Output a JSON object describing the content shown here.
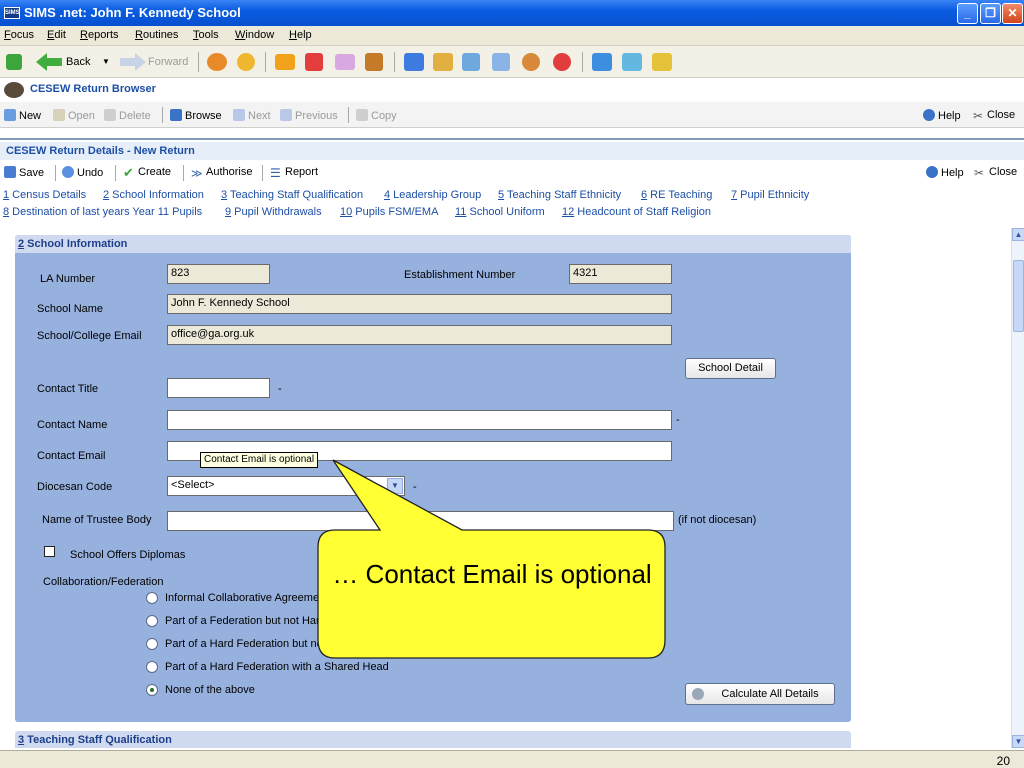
{
  "window": {
    "title": "SIMS .net: John F. Kennedy School",
    "logo_text": "SIMS"
  },
  "menu": [
    "Focus",
    "Edit",
    "Reports",
    "Routines",
    "Tools",
    "Window",
    "Help"
  ],
  "nav": {
    "back": "Back",
    "forward": "Forward"
  },
  "browser": {
    "title": "CESEW Return Browser",
    "tools": {
      "new": "New",
      "open": "Open",
      "delete": "Delete",
      "browse": "Browse",
      "next": "Next",
      "previous": "Previous",
      "copy": "Copy",
      "help": "Help",
      "close": "Close"
    }
  },
  "details": {
    "title": "CESEW Return Details - New Return",
    "tools": {
      "save": "Save",
      "undo": "Undo",
      "create": "Create",
      "authorise": "Authorise",
      "report": "Report",
      "help": "Help",
      "close": "Close"
    },
    "links_row1": [
      {
        "num": "1",
        "label": " Census Details"
      },
      {
        "num": "2",
        "label": " School Information"
      },
      {
        "num": "3",
        "label": " Teaching Staff Qualification"
      },
      {
        "num": "4",
        "label": " Leadership Group"
      },
      {
        "num": "5",
        "label": " Teaching Staff Ethnicity"
      },
      {
        "num": "6",
        "label": " RE Teaching"
      },
      {
        "num": "7",
        "label": " Pupil Ethnicity"
      }
    ],
    "links_row2": [
      {
        "num": "8",
        "label": " Destination of last years Year 11 Pupils"
      },
      {
        "num": "9",
        "label": " Pupil Withdrawals"
      },
      {
        "num": "10",
        "label": " Pupils FSM/EMA"
      },
      {
        "num": "11",
        "label": " School Uniform"
      },
      {
        "num": "12",
        "label": " Headcount of Staff Religion"
      }
    ]
  },
  "section": {
    "num": "2",
    "title": " School Information",
    "la_number_label": "LA Number",
    "la_number": "823",
    "establishment_label": "Establishment Number",
    "establishment": "4321",
    "school_name_label": "School Name",
    "school_name": "John F. Kennedy School",
    "email_label": "School/College Email",
    "email": "office@ga.org.uk",
    "school_detail_btn": "School Detail",
    "contact_title_label": "Contact Title",
    "contact_name_label": "Contact Name",
    "contact_email_label": "Contact Email",
    "diocesan_label": "Diocesan Code",
    "diocesan_value": "<Select>",
    "trustee_label": "Name of Trustee Body",
    "trustee_note": "(if not diocesan)",
    "diplomas_label": "School Offers Diplomas",
    "collab_label": "Collaboration/Federation",
    "radios": [
      "Informal Collaborative Agreement",
      "Part of a Federation but not Hard",
      "Part of a Hard Federation but no",
      "Part of a Hard Federation with a Shared Head",
      "None of the above"
    ],
    "selected_radio": 4,
    "calc_btn": "Calculate All Details",
    "required_mark": "-"
  },
  "next_section": {
    "num": "3",
    "title": " Teaching Staff Qualification"
  },
  "tooltip": "Contact Email is optional",
  "callout": "… Contact Email is optional",
  "status": {
    "page_number": "20"
  }
}
